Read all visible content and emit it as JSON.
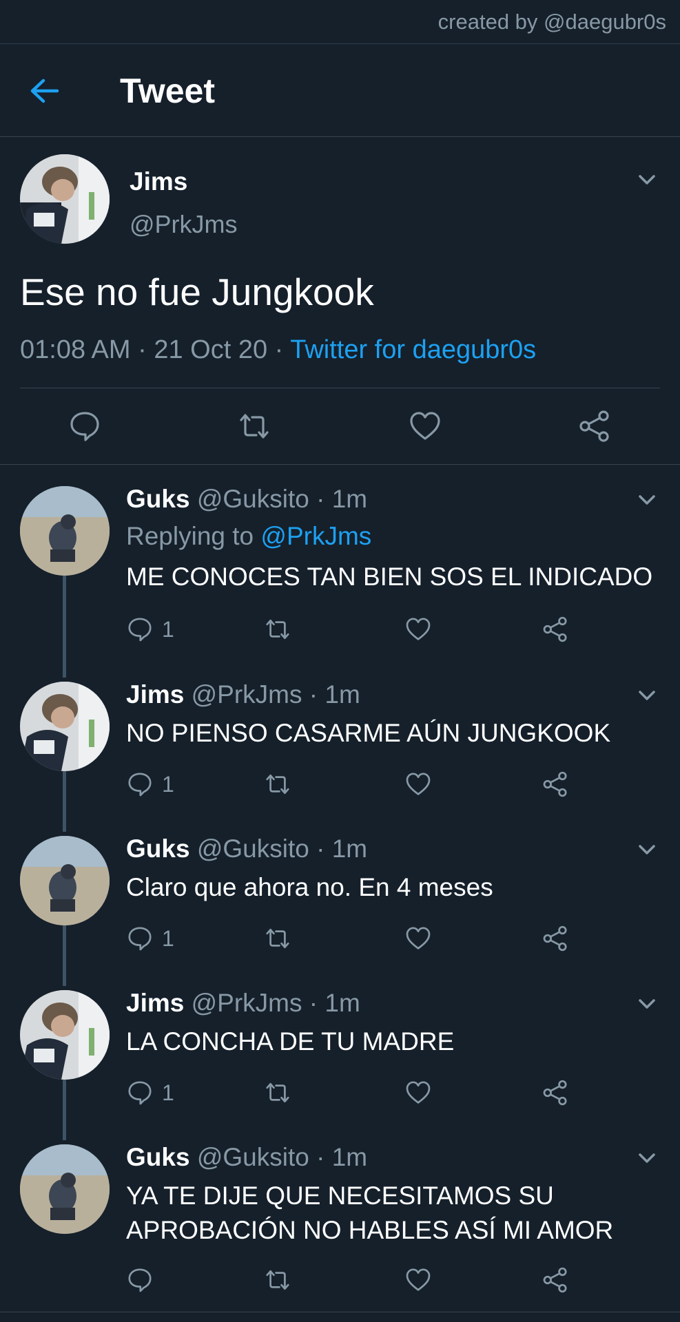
{
  "watermark": "created by @daegubr0s",
  "header": {
    "title": "Tweet",
    "back_icon": "arrow-left-icon"
  },
  "colors": {
    "background": "#15202b",
    "accent": "#1da1f2",
    "secondary_text": "#8899a6",
    "divider": "#38444d"
  },
  "main_tweet": {
    "name": "Jims",
    "handle": "@PrkJms",
    "text": "Ese no fue Jungkook",
    "time": "01:08 AM",
    "date": "21 Oct 20",
    "source": "Twitter for daegubr0s",
    "actions": [
      "reply-icon",
      "retweet-icon",
      "like-icon",
      "share-icon"
    ]
  },
  "replies": [
    {
      "name": "Guks",
      "handle": "@Guksito",
      "time": "1m",
      "replying_to_label": "Replying to",
      "replying_to": "@PrkJms",
      "text": "ME CONOCES TAN BIEN SOS EL INDICADO",
      "reply_count": "1"
    },
    {
      "name": "Jims",
      "handle": "@PrkJms",
      "time": "1m",
      "text": "NO PIENSO CASARME AÚN JUNGKOOK",
      "reply_count": "1"
    },
    {
      "name": "Guks",
      "handle": "@Guksito",
      "time": "1m",
      "text": "Claro que ahora no. En 4 meses",
      "reply_count": "1"
    },
    {
      "name": "Jims",
      "handle": "@PrkJms",
      "time": "1m",
      "text": "LA CONCHA DE TU MADRE",
      "reply_count": "1"
    },
    {
      "name": "Guks",
      "handle": "@Guksito",
      "time": "1m",
      "text_lines": [
        "YA TE DIJE QUE NECESITAMOS SU",
        "APROBACIÓN NO HABLES ASÍ MI AMOR"
      ],
      "reply_count": ""
    }
  ]
}
